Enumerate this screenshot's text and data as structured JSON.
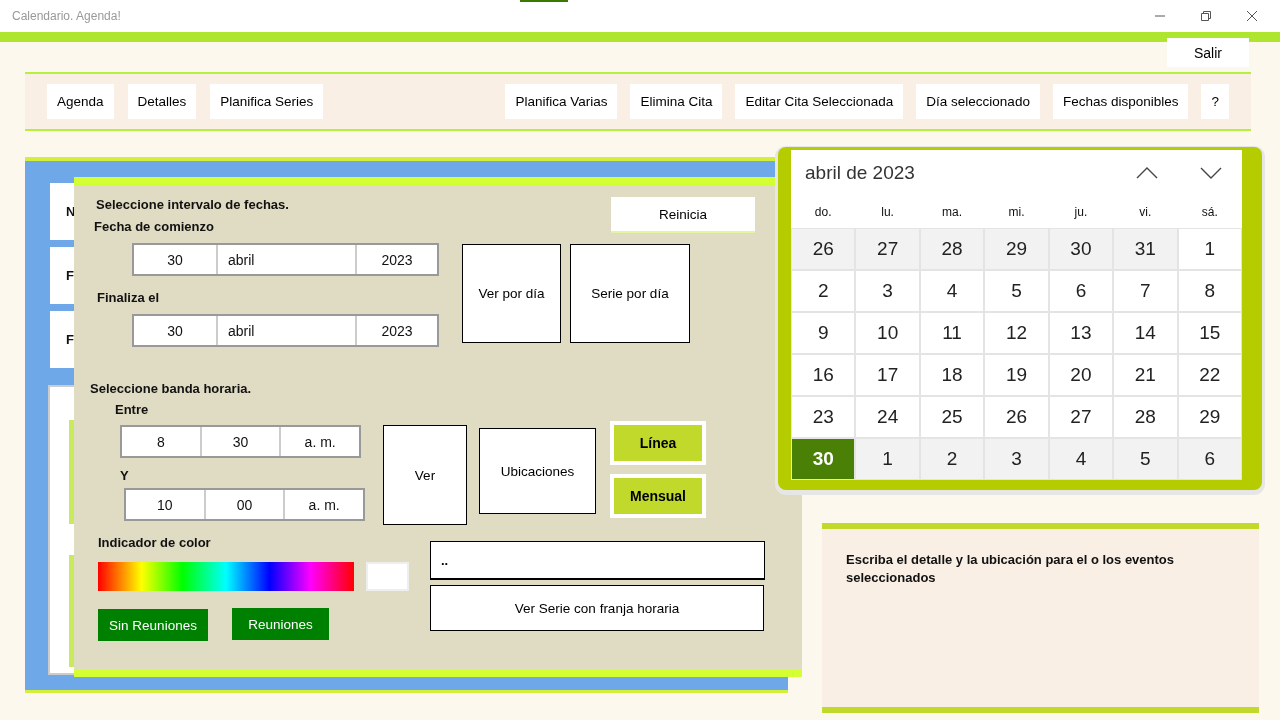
{
  "window": {
    "title": "Calendario. Agenda!"
  },
  "exit_button": "Salir",
  "toolbar": {
    "left_buttons": [
      "Agenda",
      "Detalles",
      "Planifica Series"
    ],
    "right_buttons": [
      "Planifica Varias",
      "Elimina Cita",
      "Editar Cita Seleccionada",
      "Día seleccionado",
      "Fechas disponibles",
      "?"
    ]
  },
  "background_panel": {
    "cards": [
      "N",
      "F",
      "F"
    ]
  },
  "date_range": {
    "heading": "Seleccione intervalo de fechas.",
    "reset_button": "Reinicia",
    "start": {
      "label": "Fecha de comienzo",
      "day": "30",
      "month": "abril",
      "year": "2023"
    },
    "end": {
      "label": "Finaliza el",
      "day": "30",
      "month": "abril",
      "year": "2023"
    },
    "buttons": [
      "Ver por día",
      "Serie por día"
    ]
  },
  "time_band": {
    "heading": "Seleccione banda horaria.",
    "from": {
      "label": "Entre",
      "hour": "8",
      "minute": "30",
      "period": "a. m."
    },
    "to": {
      "label": "Y",
      "hour": "10",
      "minute": "00",
      "period": "a. m."
    },
    "view_button": "Ver",
    "locations_button": "Ubicaciones",
    "toggles": [
      "Línea",
      "Mensual"
    ]
  },
  "color": {
    "label": "Indicador de color",
    "buttons": [
      "Sin Reuniones",
      "Reuniones"
    ]
  },
  "note_field": {
    "value": ".."
  },
  "series_button": "Ver Serie con franja horaria",
  "calendar": {
    "month": "abril de 2023",
    "weekdays": [
      "do.",
      "lu.",
      "ma.",
      "mi.",
      "ju.",
      "vi.",
      "sá."
    ],
    "days": [
      {
        "label": "26",
        "kind": "other",
        "selected": false
      },
      {
        "label": "27",
        "kind": "other",
        "selected": false
      },
      {
        "label": "28",
        "kind": "other",
        "selected": false
      },
      {
        "label": "29",
        "kind": "other",
        "selected": false
      },
      {
        "label": "30",
        "kind": "other",
        "selected": false
      },
      {
        "label": "31",
        "kind": "other",
        "selected": false
      },
      {
        "label": "1",
        "kind": "current",
        "selected": false
      },
      {
        "label": "2",
        "kind": "current",
        "selected": false
      },
      {
        "label": "3",
        "kind": "current",
        "selected": false
      },
      {
        "label": "4",
        "kind": "current",
        "selected": false
      },
      {
        "label": "5",
        "kind": "current",
        "selected": false
      },
      {
        "label": "6",
        "kind": "current",
        "selected": false
      },
      {
        "label": "7",
        "kind": "current",
        "selected": false
      },
      {
        "label": "8",
        "kind": "current",
        "selected": false
      },
      {
        "label": "9",
        "kind": "current",
        "selected": false
      },
      {
        "label": "10",
        "kind": "current",
        "selected": false
      },
      {
        "label": "11",
        "kind": "current",
        "selected": false
      },
      {
        "label": "12",
        "kind": "current",
        "selected": false
      },
      {
        "label": "13",
        "kind": "current",
        "selected": false
      },
      {
        "label": "14",
        "kind": "current",
        "selected": false
      },
      {
        "label": "15",
        "kind": "current",
        "selected": false
      },
      {
        "label": "16",
        "kind": "current",
        "selected": false
      },
      {
        "label": "17",
        "kind": "current",
        "selected": false
      },
      {
        "label": "18",
        "kind": "current",
        "selected": false
      },
      {
        "label": "19",
        "kind": "current",
        "selected": false
      },
      {
        "label": "20",
        "kind": "current",
        "selected": false
      },
      {
        "label": "21",
        "kind": "current",
        "selected": false
      },
      {
        "label": "22",
        "kind": "current",
        "selected": false
      },
      {
        "label": "23",
        "kind": "current",
        "selected": false
      },
      {
        "label": "24",
        "kind": "current",
        "selected": false
      },
      {
        "label": "25",
        "kind": "current",
        "selected": false
      },
      {
        "label": "26",
        "kind": "current",
        "selected": false
      },
      {
        "label": "27",
        "kind": "current",
        "selected": false
      },
      {
        "label": "28",
        "kind": "current",
        "selected": false
      },
      {
        "label": "29",
        "kind": "current",
        "selected": false
      },
      {
        "label": "30",
        "kind": "current",
        "selected": true
      },
      {
        "label": "1",
        "kind": "other",
        "selected": false
      },
      {
        "label": "2",
        "kind": "other",
        "selected": false
      },
      {
        "label": "3",
        "kind": "other",
        "selected": false
      },
      {
        "label": "4",
        "kind": "other",
        "selected": false
      },
      {
        "label": "5",
        "kind": "other",
        "selected": false
      },
      {
        "label": "6",
        "kind": "other",
        "selected": false
      }
    ]
  },
  "details": {
    "text": "Escriba el detalle y la ubicación para el o los eventos seleccionados"
  }
}
